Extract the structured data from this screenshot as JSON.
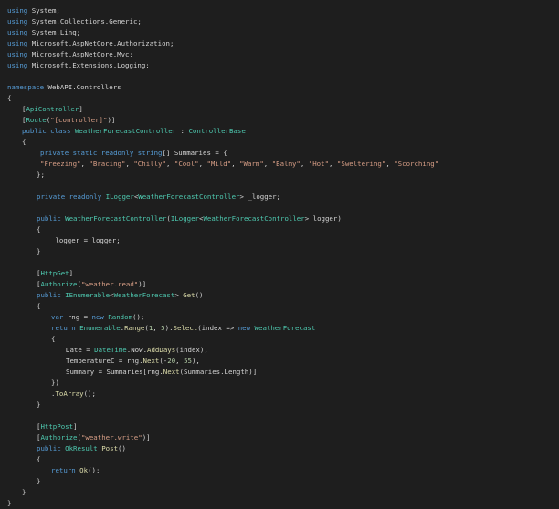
{
  "theme": {
    "background": "#1e1e1e",
    "colors": {
      "keyword": "#569cd6",
      "type": "#4ec9b0",
      "string": "#d69d85",
      "method": "#dcdcaa",
      "number": "#b5cea8",
      "text": "#d4d4d4"
    }
  },
  "editor": {
    "lines": [
      {
        "indent": 1,
        "tokens": [
          {
            "t": "keyword",
            "v": "using"
          },
          {
            "t": "text",
            "v": " System;"
          }
        ]
      },
      {
        "indent": 1,
        "tokens": [
          {
            "t": "keyword",
            "v": "using"
          },
          {
            "t": "text",
            "v": " System.Collections.Generic;"
          }
        ]
      },
      {
        "indent": 1,
        "tokens": [
          {
            "t": "keyword",
            "v": "using"
          },
          {
            "t": "text",
            "v": " System.Linq;"
          }
        ]
      },
      {
        "indent": 1,
        "tokens": [
          {
            "t": "keyword",
            "v": "using"
          },
          {
            "t": "text",
            "v": " Microsoft.AspNetCore.Authorization;"
          }
        ]
      },
      {
        "indent": 1,
        "tokens": [
          {
            "t": "keyword",
            "v": "using"
          },
          {
            "t": "text",
            "v": " Microsoft.AspNetCore.Mvc;"
          }
        ]
      },
      {
        "indent": 1,
        "tokens": [
          {
            "t": "keyword",
            "v": "using"
          },
          {
            "t": "text",
            "v": " Microsoft.Extensions.Logging;"
          }
        ]
      },
      {
        "indent": 0,
        "tokens": []
      },
      {
        "indent": 1,
        "tokens": [
          {
            "t": "keyword",
            "v": "namespace"
          },
          {
            "t": "text",
            "v": " WebAPI.Controllers"
          }
        ]
      },
      {
        "indent": 1,
        "tokens": [
          {
            "t": "text",
            "v": "{"
          }
        ]
      },
      {
        "indent": 5,
        "tokens": [
          {
            "t": "text",
            "v": "["
          },
          {
            "t": "attribute",
            "v": "ApiController"
          },
          {
            "t": "text",
            "v": "]"
          }
        ]
      },
      {
        "indent": 5,
        "tokens": [
          {
            "t": "text",
            "v": "["
          },
          {
            "t": "attribute",
            "v": "Route"
          },
          {
            "t": "text",
            "v": "("
          },
          {
            "t": "string",
            "v": "\"[controller]\""
          },
          {
            "t": "text",
            "v": ")]"
          }
        ]
      },
      {
        "indent": 5,
        "tokens": [
          {
            "t": "keyword",
            "v": "public class"
          },
          {
            "t": "text",
            "v": " "
          },
          {
            "t": "type",
            "v": "WeatherForecastController"
          },
          {
            "t": "text",
            "v": " : "
          },
          {
            "t": "type",
            "v": "ControllerBase"
          }
        ]
      },
      {
        "indent": 5,
        "tokens": [
          {
            "t": "text",
            "v": "{"
          }
        ]
      },
      {
        "indent": 10,
        "tokens": [
          {
            "t": "keyword",
            "v": "private static readonly string"
          },
          {
            "t": "text",
            "v": "[] Summaries = {"
          }
        ]
      },
      {
        "indent": 10,
        "tokens": [
          {
            "t": "string",
            "v": "\"Freezing\""
          },
          {
            "t": "text",
            "v": ", "
          },
          {
            "t": "string",
            "v": "\"Bracing\""
          },
          {
            "t": "text",
            "v": ", "
          },
          {
            "t": "string",
            "v": "\"Chilly\""
          },
          {
            "t": "text",
            "v": ", "
          },
          {
            "t": "string",
            "v": "\"Cool\""
          },
          {
            "t": "text",
            "v": ", "
          },
          {
            "t": "string",
            "v": "\"Mild\""
          },
          {
            "t": "text",
            "v": ", "
          },
          {
            "t": "string",
            "v": "\"Warm\""
          },
          {
            "t": "text",
            "v": ", "
          },
          {
            "t": "string",
            "v": "\"Balmy\""
          },
          {
            "t": "text",
            "v": ", "
          },
          {
            "t": "string",
            "v": "\"Hot\""
          },
          {
            "t": "text",
            "v": ", "
          },
          {
            "t": "string",
            "v": "\"Sweltering\""
          },
          {
            "t": "text",
            "v": ", "
          },
          {
            "t": "string",
            "v": "\"Scorching\""
          }
        ]
      },
      {
        "indent": 9,
        "tokens": [
          {
            "t": "text",
            "v": "};"
          }
        ]
      },
      {
        "indent": 0,
        "tokens": []
      },
      {
        "indent": 9,
        "tokens": [
          {
            "t": "keyword",
            "v": "private readonly"
          },
          {
            "t": "text",
            "v": " "
          },
          {
            "t": "type",
            "v": "ILogger"
          },
          {
            "t": "text",
            "v": "<"
          },
          {
            "t": "type",
            "v": "WeatherForecastController"
          },
          {
            "t": "text",
            "v": "> _logger;"
          }
        ]
      },
      {
        "indent": 0,
        "tokens": []
      },
      {
        "indent": 9,
        "tokens": [
          {
            "t": "keyword",
            "v": "public"
          },
          {
            "t": "text",
            "v": " "
          },
          {
            "t": "type",
            "v": "WeatherForecastController"
          },
          {
            "t": "text",
            "v": "("
          },
          {
            "t": "type",
            "v": "ILogger"
          },
          {
            "t": "text",
            "v": "<"
          },
          {
            "t": "type",
            "v": "WeatherForecastController"
          },
          {
            "t": "text",
            "v": "> logger)"
          }
        ]
      },
      {
        "indent": 9,
        "tokens": [
          {
            "t": "text",
            "v": "{"
          }
        ]
      },
      {
        "indent": 13,
        "tokens": [
          {
            "t": "text",
            "v": "_logger = logger;"
          }
        ]
      },
      {
        "indent": 9,
        "tokens": [
          {
            "t": "text",
            "v": "}"
          }
        ]
      },
      {
        "indent": 0,
        "tokens": []
      },
      {
        "indent": 9,
        "tokens": [
          {
            "t": "text",
            "v": "["
          },
          {
            "t": "attribute",
            "v": "HttpGet"
          },
          {
            "t": "text",
            "v": "]"
          }
        ]
      },
      {
        "indent": 9,
        "tokens": [
          {
            "t": "text",
            "v": "["
          },
          {
            "t": "attribute",
            "v": "Authorize"
          },
          {
            "t": "text",
            "v": "("
          },
          {
            "t": "string",
            "v": "\"weather.read\""
          },
          {
            "t": "text",
            "v": ")]"
          }
        ]
      },
      {
        "indent": 9,
        "tokens": [
          {
            "t": "keyword",
            "v": "public"
          },
          {
            "t": "text",
            "v": " "
          },
          {
            "t": "type",
            "v": "IEnumerable"
          },
          {
            "t": "text",
            "v": "<"
          },
          {
            "t": "type",
            "v": "WeatherForecast"
          },
          {
            "t": "text",
            "v": "> "
          },
          {
            "t": "method",
            "v": "Get"
          },
          {
            "t": "text",
            "v": "()"
          }
        ]
      },
      {
        "indent": 9,
        "tokens": [
          {
            "t": "text",
            "v": "{"
          }
        ]
      },
      {
        "indent": 13,
        "tokens": [
          {
            "t": "keyword",
            "v": "var"
          },
          {
            "t": "text",
            "v": " rng = "
          },
          {
            "t": "keyword",
            "v": "new"
          },
          {
            "t": "text",
            "v": " "
          },
          {
            "t": "type",
            "v": "Random"
          },
          {
            "t": "text",
            "v": "();"
          }
        ]
      },
      {
        "indent": 13,
        "tokens": [
          {
            "t": "keyword",
            "v": "return"
          },
          {
            "t": "text",
            "v": " "
          },
          {
            "t": "type",
            "v": "Enumerable"
          },
          {
            "t": "text",
            "v": "."
          },
          {
            "t": "method",
            "v": "Range"
          },
          {
            "t": "text",
            "v": "("
          },
          {
            "t": "number",
            "v": "1"
          },
          {
            "t": "text",
            "v": ", "
          },
          {
            "t": "number",
            "v": "5"
          },
          {
            "t": "text",
            "v": ")."
          },
          {
            "t": "method",
            "v": "Select"
          },
          {
            "t": "text",
            "v": "(index => "
          },
          {
            "t": "keyword",
            "v": "new"
          },
          {
            "t": "text",
            "v": " "
          },
          {
            "t": "type",
            "v": "WeatherForecast"
          }
        ]
      },
      {
        "indent": 13,
        "tokens": [
          {
            "t": "text",
            "v": "{"
          }
        ]
      },
      {
        "indent": 17,
        "tokens": [
          {
            "t": "text",
            "v": "Date = "
          },
          {
            "t": "type",
            "v": "DateTime"
          },
          {
            "t": "text",
            "v": ".Now."
          },
          {
            "t": "method",
            "v": "AddDays"
          },
          {
            "t": "text",
            "v": "(index),"
          }
        ]
      },
      {
        "indent": 17,
        "tokens": [
          {
            "t": "text",
            "v": "TemperatureC = rng."
          },
          {
            "t": "method",
            "v": "Next"
          },
          {
            "t": "text",
            "v": "(-"
          },
          {
            "t": "number",
            "v": "20"
          },
          {
            "t": "text",
            "v": ", "
          },
          {
            "t": "number",
            "v": "55"
          },
          {
            "t": "text",
            "v": "),"
          }
        ]
      },
      {
        "indent": 17,
        "tokens": [
          {
            "t": "text",
            "v": "Summary = Summaries[rng."
          },
          {
            "t": "method",
            "v": "Next"
          },
          {
            "t": "text",
            "v": "(Summaries.Length)]"
          }
        ]
      },
      {
        "indent": 13,
        "tokens": [
          {
            "t": "text",
            "v": "})"
          }
        ]
      },
      {
        "indent": 13,
        "tokens": [
          {
            "t": "text",
            "v": "."
          },
          {
            "t": "method",
            "v": "ToArray"
          },
          {
            "t": "text",
            "v": "();"
          }
        ]
      },
      {
        "indent": 9,
        "tokens": [
          {
            "t": "text",
            "v": "}"
          }
        ]
      },
      {
        "indent": 0,
        "tokens": []
      },
      {
        "indent": 9,
        "tokens": [
          {
            "t": "text",
            "v": "["
          },
          {
            "t": "attribute",
            "v": "HttpPost"
          },
          {
            "t": "text",
            "v": "]"
          }
        ]
      },
      {
        "indent": 9,
        "tokens": [
          {
            "t": "text",
            "v": "["
          },
          {
            "t": "attribute",
            "v": "Authorize"
          },
          {
            "t": "text",
            "v": "("
          },
          {
            "t": "string",
            "v": "\"weather.write\""
          },
          {
            "t": "text",
            "v": ")]"
          }
        ]
      },
      {
        "indent": 9,
        "tokens": [
          {
            "t": "keyword",
            "v": "public"
          },
          {
            "t": "text",
            "v": " "
          },
          {
            "t": "type",
            "v": "OkResult"
          },
          {
            "t": "text",
            "v": " "
          },
          {
            "t": "method",
            "v": "Post"
          },
          {
            "t": "text",
            "v": "()"
          }
        ]
      },
      {
        "indent": 9,
        "tokens": [
          {
            "t": "text",
            "v": "{"
          }
        ]
      },
      {
        "indent": 13,
        "tokens": [
          {
            "t": "keyword",
            "v": "return"
          },
          {
            "t": "text",
            "v": " "
          },
          {
            "t": "method",
            "v": "Ok"
          },
          {
            "t": "text",
            "v": "();"
          }
        ]
      },
      {
        "indent": 9,
        "tokens": [
          {
            "t": "text",
            "v": "}"
          }
        ]
      },
      {
        "indent": 5,
        "tokens": [
          {
            "t": "text",
            "v": "}"
          }
        ]
      },
      {
        "indent": 1,
        "tokens": [
          {
            "t": "text",
            "v": "}"
          }
        ]
      }
    ]
  }
}
